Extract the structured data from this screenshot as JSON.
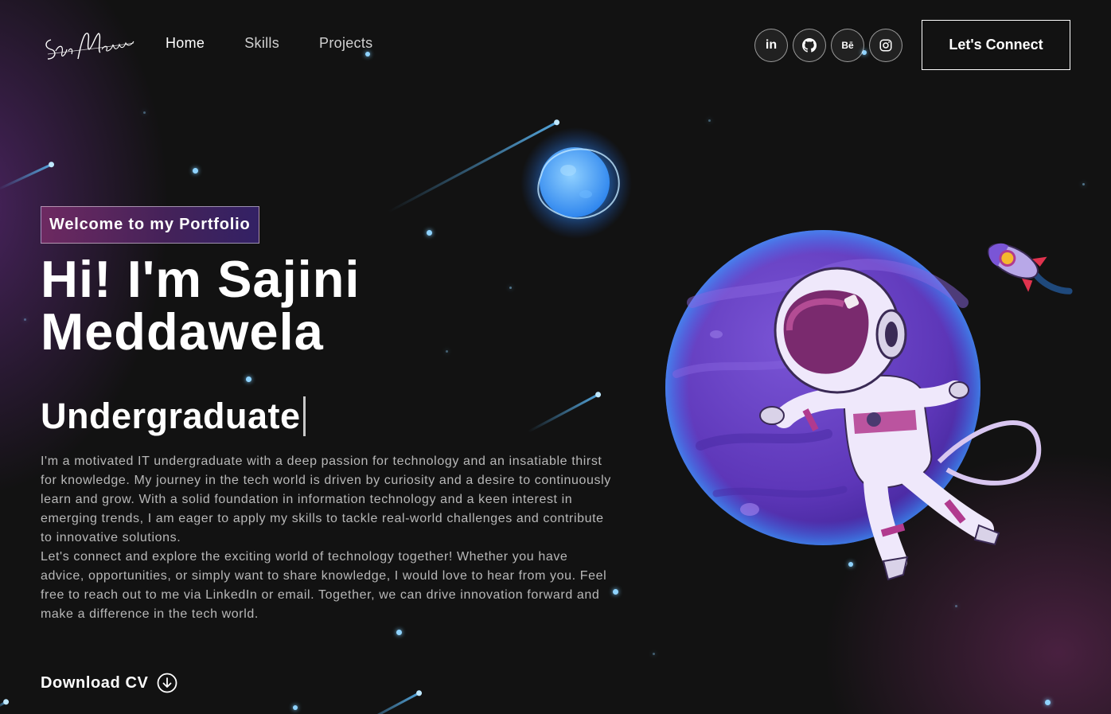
{
  "nav": {
    "logo_alt": "Sajini Meddawela",
    "links": [
      {
        "label": "Home"
      },
      {
        "label": "Skills"
      },
      {
        "label": "Projects"
      }
    ],
    "social": [
      {
        "icon": "linkedin-icon",
        "label": "in"
      },
      {
        "icon": "github-icon",
        "label": ""
      },
      {
        "icon": "behance-icon",
        "label": "Bē"
      },
      {
        "icon": "instagram-icon",
        "label": ""
      }
    ],
    "connect_label": "Let's Connect"
  },
  "hero": {
    "tagline": "Welcome to my Portfolio",
    "title_line1": "Hi! I'm Sajini",
    "title_line2": "Meddawela",
    "role": "Undergraduate",
    "paragraph1": "I'm a motivated IT undergraduate with a deep passion for technology and an insatiable thirst for knowledge. My journey in the tech world is driven by curiosity and a desire to continuously learn and grow. With a solid foundation in information technology and a keen interest in emerging trends, I am eager to apply my skills to tackle real-world challenges and contribute to innovative solutions.",
    "paragraph2": "Let's connect and explore the exciting world of technology together! Whether you have advice, opportunities, or simply want to share knowledge, I would love to hear from you. Feel free to reach out to me via LinkedIn or email. Together, we can drive innovation forward and make a difference in the tech world.",
    "download_label": "Download CV"
  },
  "theme": {
    "background": "#121212",
    "tagline_gradient_start": "#aa367c",
    "tagline_gradient_end": "#4a2fbd",
    "planet": "#6b3fc4",
    "star": "#8fd3ff"
  }
}
